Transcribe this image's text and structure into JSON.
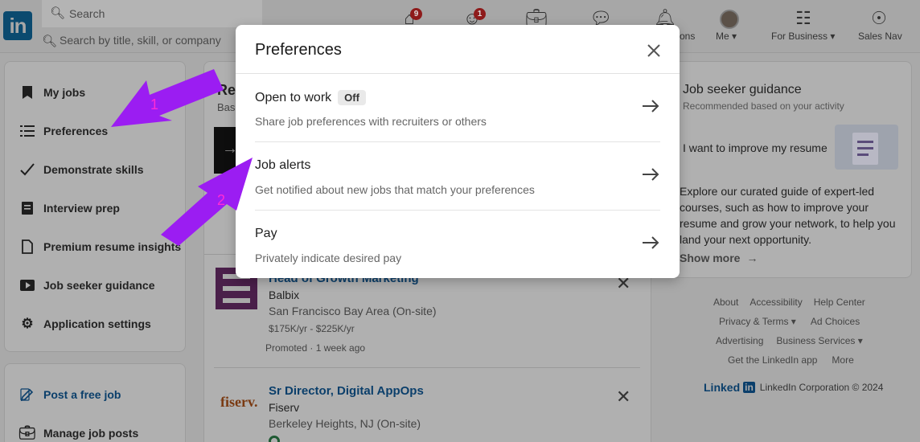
{
  "nav": {
    "logo": "in",
    "search_placeholder": "Search",
    "location_placeholder": "Search by title, skill, or company",
    "home_badge": "9",
    "network_badge": "1",
    "notifications_label": "ons",
    "me_label": "Me",
    "for_business_label": "For Business",
    "sales_nav_label": "Sales Nav"
  },
  "sidebar": {
    "items": [
      {
        "label": "My jobs",
        "icon": "bookmark-icon"
      },
      {
        "label": "Preferences",
        "icon": "list-icon"
      },
      {
        "label": "Demonstrate skills",
        "icon": "check-icon"
      },
      {
        "label": "Interview prep",
        "icon": "notes-icon"
      },
      {
        "label": "Premium resume insights",
        "icon": "document-icon"
      },
      {
        "label": "Job seeker guidance",
        "icon": "play-icon"
      },
      {
        "label": "Application settings",
        "icon": "gear-icon"
      }
    ],
    "post_job": "Post a free job",
    "manage_posts": "Manage job posts"
  },
  "feed": {
    "title_partial": "Rec",
    "sub_partial": "Bas",
    "jobs": [
      {
        "title": "Head of Growth Marketing",
        "company": "Balbix",
        "location": "San Francisco Bay Area (On-site)",
        "salary": "$175K/yr - $225K/yr",
        "meta": "Promoted · 1 week ago"
      },
      {
        "title": "Sr Director, Digital AppOps",
        "company": "Fiserv",
        "logo_text": "fiserv.",
        "location": "Berkeley Heights, NJ (On-site)"
      }
    ]
  },
  "right": {
    "guidance_title": "Job seeker guidance",
    "guidance_sub": "Recommended based on your activity",
    "resume_heading": "I want to improve my resume",
    "body": "Explore our curated guide of expert-led courses, such as how to improve your resume and grow your network, to help you land your next opportunity.",
    "show_more": "Show more",
    "footer": {
      "row1": [
        "About",
        "Accessibility",
        "Help Center"
      ],
      "row2": [
        "Privacy & Terms",
        "Ad Choices"
      ],
      "row3": [
        "Advertising",
        "Business Services"
      ],
      "row4": [
        "Get the LinkedIn app",
        "More"
      ],
      "brand": "Linked",
      "brand_in": "in",
      "copyright": "LinkedIn Corporation © 2024"
    }
  },
  "modal": {
    "title": "Preferences",
    "rows": [
      {
        "label": "Open to work",
        "badge": "Off",
        "desc": "Share job preferences with recruiters or others"
      },
      {
        "label": "Job alerts",
        "desc": "Get notified about new jobs that match your preferences"
      },
      {
        "label": "Pay",
        "desc": "Privately indicate desired pay"
      }
    ]
  },
  "annotations": {
    "step1": "1",
    "step2": "2",
    "color": "#9b1df2"
  }
}
